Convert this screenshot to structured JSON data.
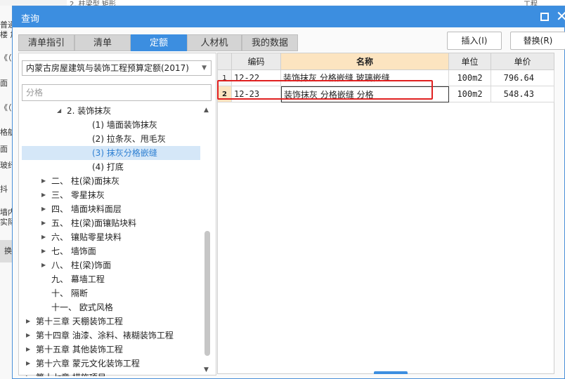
{
  "background": {
    "top_fragments": [
      "2. 柱梁型 矩形",
      "工程"
    ],
    "left_fragments": [
      "普通",
      "楼 加",
      "《（",
      "面",
      "《（",
      "格航",
      "面",
      "玻纤",
      "抖",
      "墙内",
      "实际",
      "换"
    ]
  },
  "dialog": {
    "title": "查询",
    "tabs": [
      {
        "label": "清单指引",
        "active": false
      },
      {
        "label": "清单",
        "active": false
      },
      {
        "label": "定额",
        "active": true
      },
      {
        "label": "人材机",
        "active": false
      },
      {
        "label": "我的数据",
        "active": false
      }
    ],
    "insert_label": "插入(I)",
    "replace_label": "替换(R)",
    "quota_select": "内蒙古房屋建筑与装饰工程预算定额(2017)",
    "search_value": "分格"
  },
  "tree": [
    {
      "label": "2. 装饰抹灰",
      "indent": 2,
      "expander": "expanded"
    },
    {
      "label": "(1) 墙面装饰抹灰",
      "indent": 3,
      "expander": "none"
    },
    {
      "label": "(2) 拉条灰、甩毛灰",
      "indent": 3,
      "expander": "none"
    },
    {
      "label": "(3) 抹灰分格嵌缝",
      "indent": 3,
      "expander": "none",
      "selected": true
    },
    {
      "label": "(4) 打底",
      "indent": 3,
      "expander": "none"
    },
    {
      "label": "二、 柱(梁)面抹灰",
      "indent": 1,
      "expander": "collapsed"
    },
    {
      "label": "三、 零星抹灰",
      "indent": 1,
      "expander": "collapsed"
    },
    {
      "label": "四、 墙面块料面层",
      "indent": 1,
      "expander": "collapsed"
    },
    {
      "label": "五、 柱(梁)面镶贴块料",
      "indent": 1,
      "expander": "collapsed"
    },
    {
      "label": "六、 镶贴零星块料",
      "indent": 1,
      "expander": "collapsed"
    },
    {
      "label": "七、 墙饰面",
      "indent": 1,
      "expander": "collapsed"
    },
    {
      "label": "八、 柱(梁)饰面",
      "indent": 1,
      "expander": "collapsed"
    },
    {
      "label": "九、 幕墙工程",
      "indent": 1,
      "expander": "none"
    },
    {
      "label": "十、 隔断",
      "indent": 1,
      "expander": "none"
    },
    {
      "label": "十一、 欧式风格",
      "indent": 1,
      "expander": "none"
    },
    {
      "label": "第十三章 天棚装饰工程",
      "indent": 0,
      "expander": "collapsed"
    },
    {
      "label": "第十四章 油漆、涂料、裱糊装饰工程",
      "indent": 0,
      "expander": "collapsed"
    },
    {
      "label": "第十五章 其他装饰工程",
      "indent": 0,
      "expander": "collapsed"
    },
    {
      "label": "第十六章 蒙元文化装饰工程",
      "indent": 0,
      "expander": "collapsed"
    },
    {
      "label": "第十七章 措施项目",
      "indent": 0,
      "expander": "collapsed"
    }
  ],
  "grid": {
    "columns": [
      "编码",
      "名称",
      "单位",
      "单价"
    ],
    "rows": [
      {
        "no": "1",
        "code": "12-22",
        "name": "装饰抹灰 分格嵌缝 玻璃嵌缝",
        "unit": "100m2",
        "price": "796.64"
      },
      {
        "no": "2",
        "code": "12-23",
        "name": "装饰抹灰 分格嵌缝 分格",
        "unit": "100m2",
        "price": "548.43",
        "highlighted": true
      }
    ]
  },
  "colors": {
    "accent": "#3c8ee0",
    "highlight_border": "#e02020",
    "name_header": "#fce4c0"
  }
}
